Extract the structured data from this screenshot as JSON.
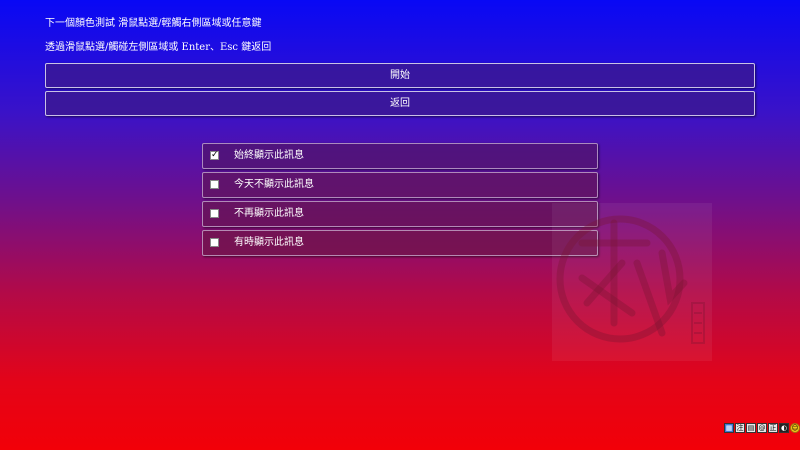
{
  "instructions": {
    "line1": "下一個顏色測試 滑鼠點選/輕觸右側區域或任意鍵",
    "line2": "透過滑鼠點選/觸碰左側區域或 Enter、Esc 鍵返回"
  },
  "buttons": {
    "start": "開始",
    "back": "返回"
  },
  "options": [
    {
      "label": "始終顯示此訊息",
      "checked": true
    },
    {
      "label": "今天不顯示此訊息",
      "checked": false
    },
    {
      "label": "不再顯示此訊息",
      "checked": false
    },
    {
      "label": "有時顯示此訊息",
      "checked": false
    }
  ],
  "tray": {
    "icons": [
      "ime-icon",
      "zhu-icon",
      "keyboard-icon",
      "at-icon",
      "zheng-icon",
      "moon-icon",
      "smile-icon"
    ],
    "glyphs": [
      "▦",
      "注",
      "▤",
      "@",
      "正",
      "◐",
      "☺"
    ]
  },
  "colors": {
    "gradient_top": "#0808f5",
    "gradient_bottom": "#f20008"
  }
}
